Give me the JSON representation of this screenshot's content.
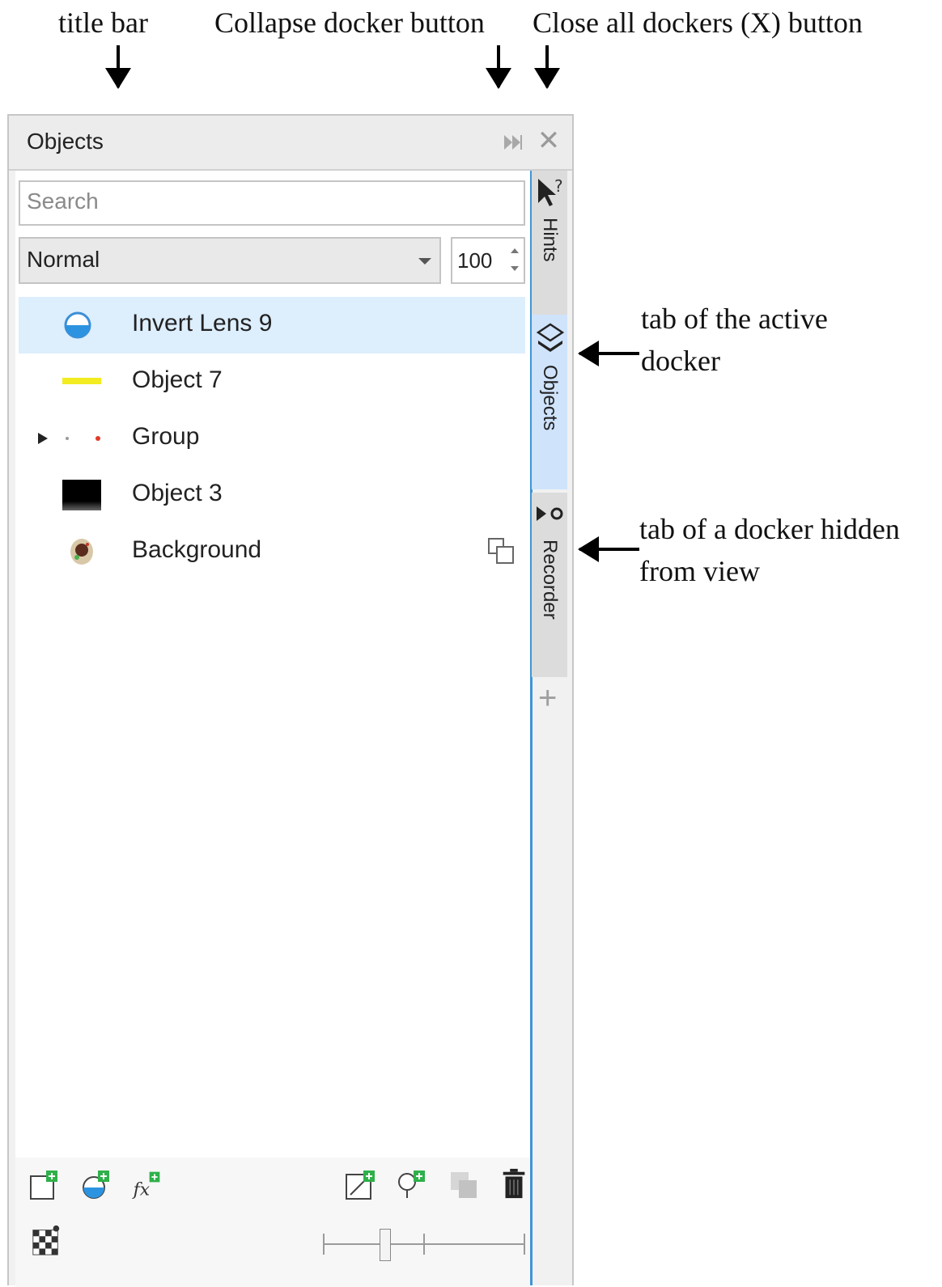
{
  "annotations": {
    "title_bar": "title bar",
    "collapse_button": "Collapse docker button",
    "close_button": "Close all dockers (X) button",
    "active_tab_line1": "tab of the active",
    "active_tab_line2": "docker",
    "hidden_tab_line1": "tab of a docker hidden",
    "hidden_tab_line2": "from view"
  },
  "docker": {
    "title": "Objects",
    "close_symbol": "✕",
    "search_placeholder": "Search",
    "blend_mode": "Normal",
    "opacity": "100",
    "objects": [
      {
        "label": "Invert Lens 9",
        "thumb": "lens-icon",
        "selected": true
      },
      {
        "label": "Object 7",
        "thumb": "yellow-line-thumbnail",
        "selected": false
      },
      {
        "label": "Group",
        "thumb": "group-dots-thumbnail",
        "selected": false,
        "expandable": true
      },
      {
        "label": "Object 3",
        "thumb": "black-rect-thumbnail",
        "selected": false
      },
      {
        "label": "Background",
        "thumb": "background-thumbnail",
        "selected": false
      }
    ]
  },
  "tabs": [
    {
      "label": "Hints",
      "icon": "cursor-question-icon",
      "active": false
    },
    {
      "label": "Objects",
      "icon": "layers-icon",
      "active": true
    },
    {
      "label": "Recorder",
      "icon": "record-icon",
      "active": false
    }
  ],
  "add_tab_symbol": "+",
  "colors": {
    "accent": "#3e95d8",
    "selected_row": "#ddeefd",
    "active_tab": "#cfe3fb",
    "add_badge": "#2fb04a"
  }
}
